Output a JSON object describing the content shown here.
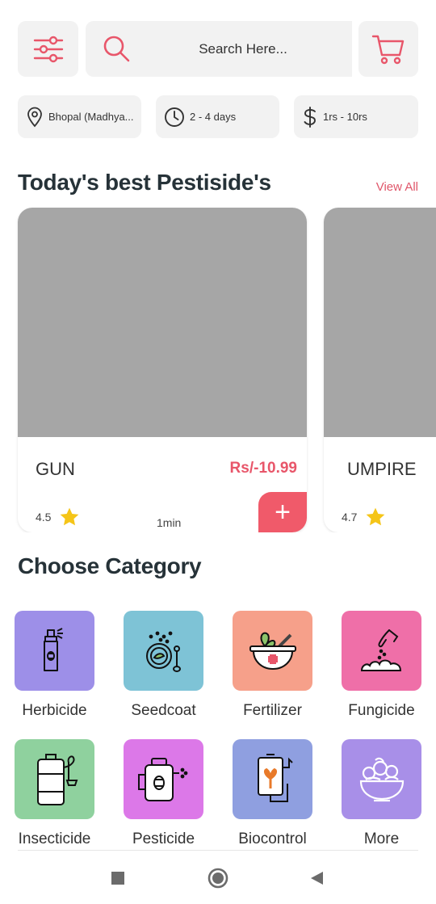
{
  "search": {
    "placeholder": "Search Here..."
  },
  "chips": {
    "location": "Bhopal (Madhya...",
    "delivery": "2 - 4 days",
    "price_range": "1rs - 10rs"
  },
  "best": {
    "title": "Today's best Pestiside's",
    "view_all": "View All",
    "products": [
      {
        "name": "GUN",
        "price": "Rs/-10.99",
        "rating": "4.5",
        "time": "1min",
        "add_label": "+"
      },
      {
        "name": "UMPIRE",
        "rating": "4.7"
      }
    ]
  },
  "categories": {
    "title": "Choose Category",
    "items": [
      {
        "label": "Herbicide",
        "color": "#9d8fe8"
      },
      {
        "label": "Seedcoat",
        "color": "#7ec3d6"
      },
      {
        "label": "Fertilizer",
        "color": "#f6a08a"
      },
      {
        "label": "Fungicide",
        "color": "#ef6fa8"
      },
      {
        "label": "Insecticide",
        "color": "#8fd19e"
      },
      {
        "label": "Pesticide",
        "color": "#dc78e8"
      },
      {
        "label": "Biocontrol",
        "color": "#8f9fe0"
      },
      {
        "label": "More",
        "color": "#a88fe8"
      }
    ]
  },
  "colors": {
    "accent": "#e8566a",
    "chip_bg": "#f2f2f2",
    "star": "#f5c518"
  },
  "icons": [
    "filter-sliders-icon",
    "search-icon",
    "cart-icon",
    "location-pin-icon",
    "clock-icon",
    "dollar-icon",
    "star-icon",
    "plus-icon"
  ]
}
